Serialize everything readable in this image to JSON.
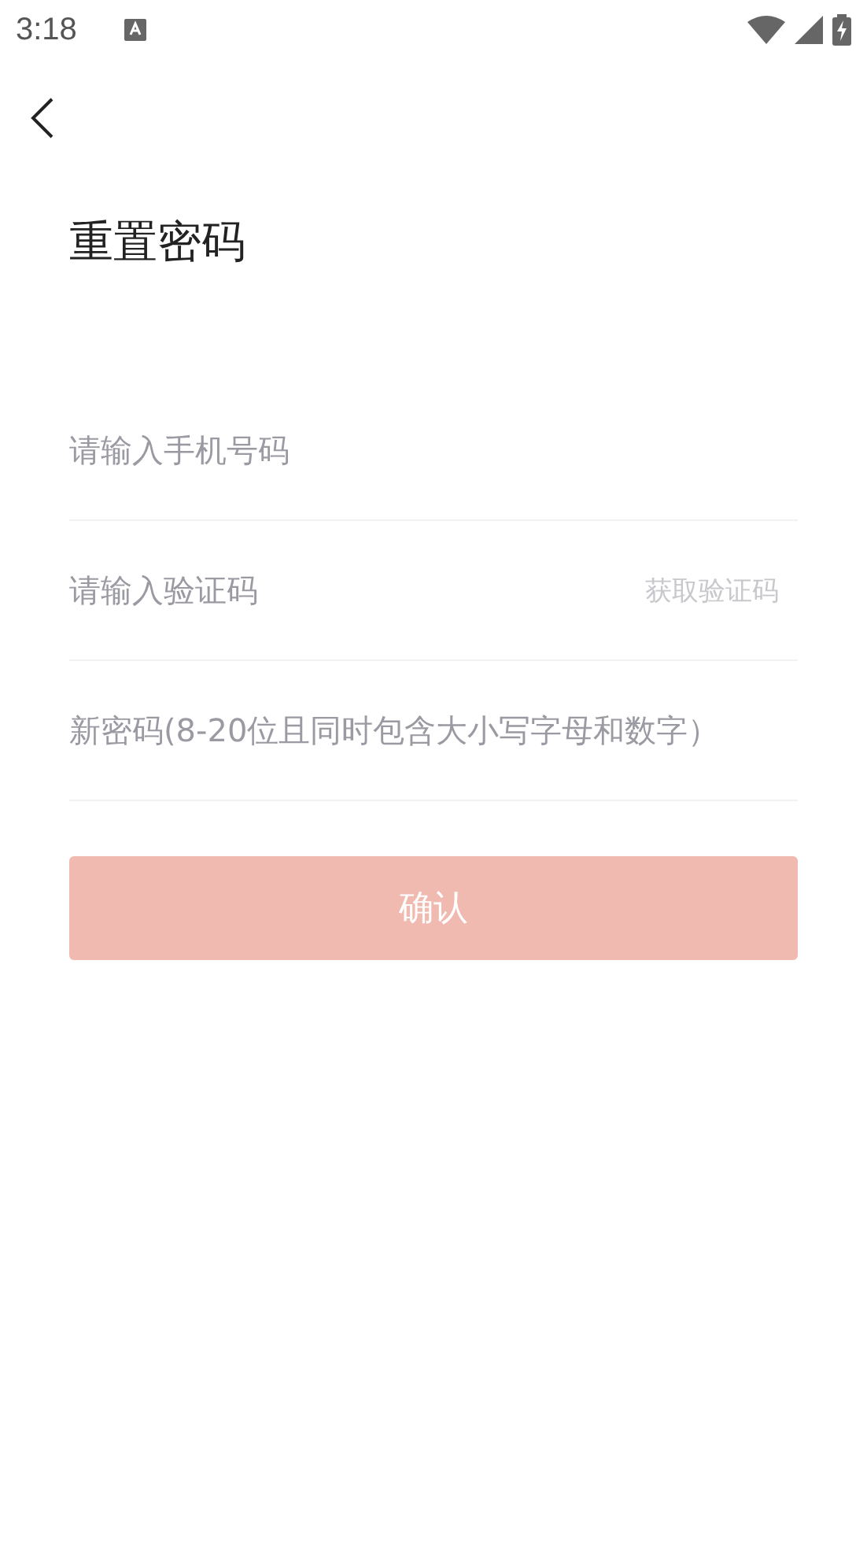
{
  "status_bar": {
    "time": "3:18"
  },
  "title": "重置密码",
  "fields": [
    {
      "kind": "text",
      "placeholder": "请输入手机号码"
    },
    {
      "kind": "code",
      "placeholder": "请输入验证码",
      "action": "获取验证码"
    },
    {
      "kind": "text",
      "placeholder": "新密码(8-20位且同时包含大小写字母和数字）"
    }
  ],
  "confirm_button": {
    "label": "确认",
    "disabled": true
  }
}
